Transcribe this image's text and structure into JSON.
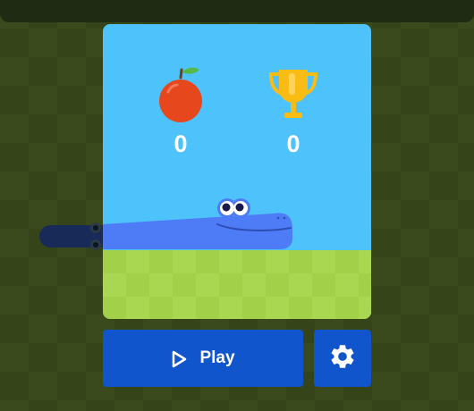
{
  "scoreboard": {
    "apples_eaten": "0",
    "high_score": "0"
  },
  "icons": {
    "apple": "apple-icon",
    "trophy": "trophy-icon",
    "play": "play-icon",
    "settings": "gear-icon"
  },
  "buttons": {
    "play_label": "Play"
  },
  "colors": {
    "sky": "#4ec2fb",
    "grass_light": "#aad751",
    "grass_dark": "#a2d149",
    "snake": "#4e7cf6",
    "button": "#1155cc",
    "apple": "#e7471d",
    "trophy": "#f9bc15"
  }
}
